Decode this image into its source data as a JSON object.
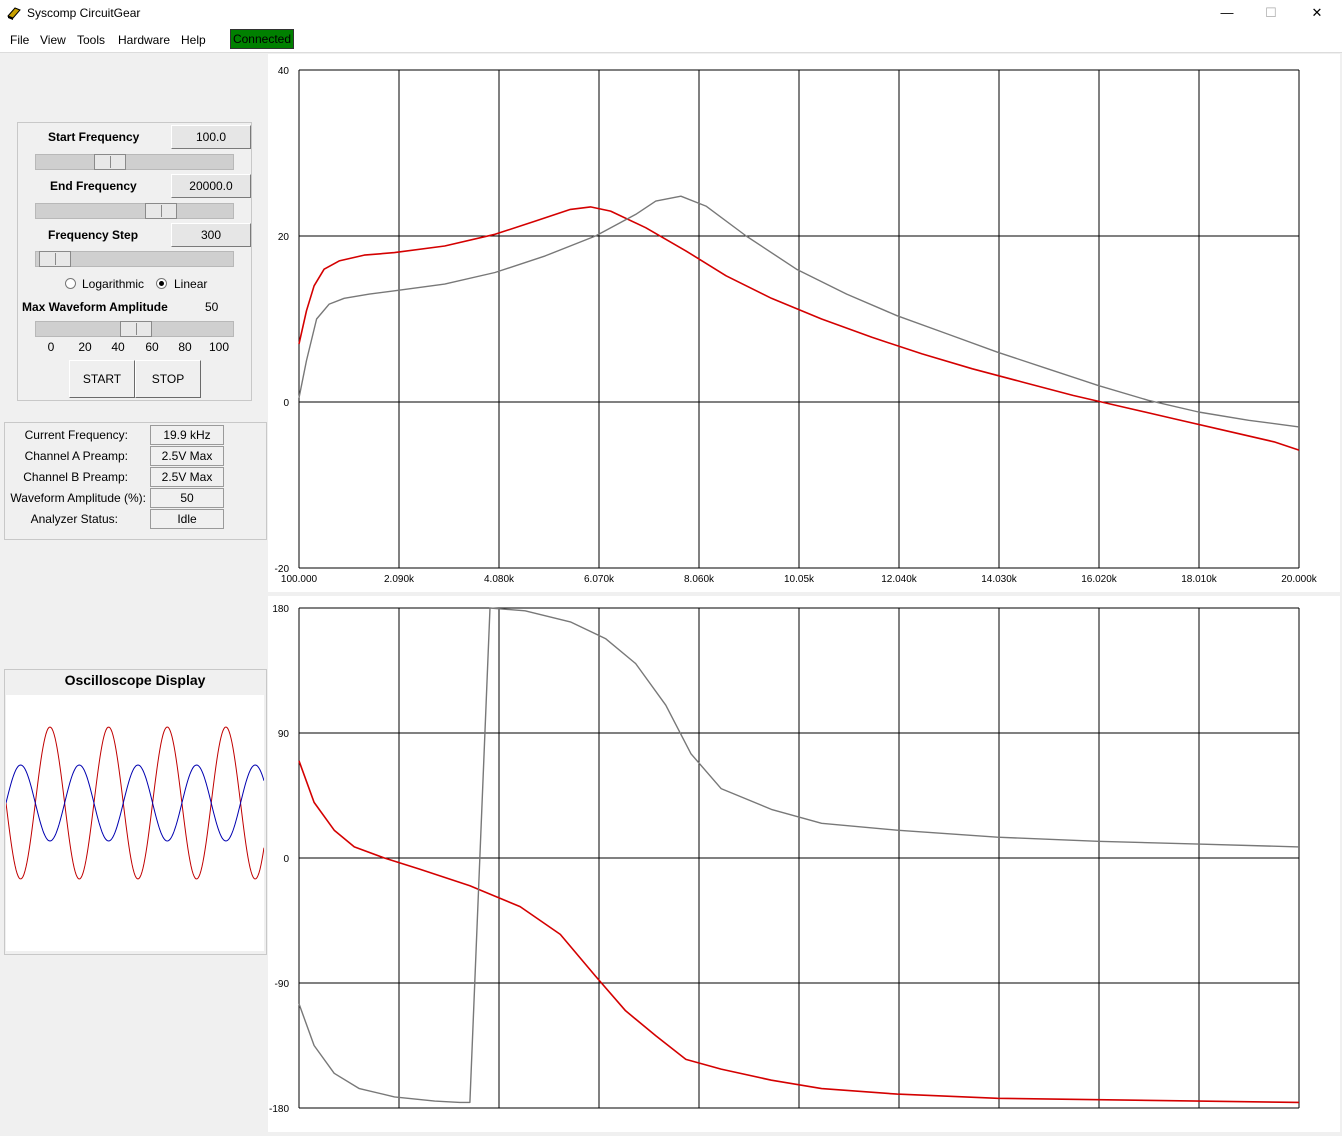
{
  "window": {
    "title": "Syscomp CircuitGear",
    "minimize": "—",
    "maximize": "☐",
    "close": "✕"
  },
  "menu": {
    "items": [
      "File",
      "View",
      "Tools",
      "Hardware",
      "Help"
    ],
    "status": "Connected",
    "status_color": "#008000"
  },
  "controls": {
    "start_frequency_label": "Start Frequency",
    "start_frequency_value": "100.0",
    "start_frequency_slider": 0.35,
    "end_frequency_label": "End Frequency",
    "end_frequency_value": "20000.0",
    "end_frequency_slider": 0.65,
    "frequency_step_label": "Frequency Step",
    "frequency_step_value": "300",
    "frequency_step_slider": 0.02,
    "scale_options": [
      "Logarithmic",
      "Linear"
    ],
    "scale_selected": "Linear",
    "max_amplitude_label": "Max Waveform Amplitude",
    "max_amplitude_value": "50",
    "max_amplitude_slider": 0.5,
    "amplitude_ticks": [
      "0",
      "20",
      "40",
      "60",
      "80",
      "100"
    ],
    "start_button": "START",
    "stop_button": "STOP"
  },
  "status": {
    "rows": [
      {
        "label": "Current Frequency:",
        "value": "19.9 kHz"
      },
      {
        "label": "Channel A Preamp:",
        "value": "2.5V Max"
      },
      {
        "label": "Channel B Preamp:",
        "value": "2.5V Max"
      },
      {
        "label": "Waveform Amplitude (%):",
        "value": "50"
      },
      {
        "label": "Analyzer Status:",
        "value": "Idle"
      }
    ]
  },
  "oscilloscope": {
    "title": "Oscilloscope Display",
    "channel_a_color": "#c00000",
    "channel_b_color": "#0000b0",
    "cycles_shown": 4.4,
    "channel_a_amplitude": 1.0,
    "channel_b_amplitude": 0.5
  },
  "chart_data": [
    {
      "type": "line",
      "title": "",
      "xlim": [
        100,
        20000
      ],
      "ylim": [
        -20,
        40
      ],
      "yticks": [
        "40",
        "20",
        "0",
        "-20"
      ],
      "xticks": [
        "100.000",
        "2.090k",
        "4.080k",
        "6.070k",
        "8.060k",
        "10.05k",
        "12.040k",
        "14.030k",
        "16.020k",
        "18.010k",
        "20.000k"
      ],
      "grid": true,
      "series": [
        {
          "color": "#d40000",
          "points": [
            [
              100,
              7
            ],
            [
              250,
              11
            ],
            [
              400,
              14
            ],
            [
              600,
              16
            ],
            [
              900,
              17
            ],
            [
              1400,
              17.7
            ],
            [
              2000,
              18.0
            ],
            [
              3000,
              18.8
            ],
            [
              4000,
              20.2
            ],
            [
              4800,
              21.8
            ],
            [
              5500,
              23.2
            ],
            [
              5900,
              23.5
            ],
            [
              6300,
              23.0
            ],
            [
              7000,
              21.0
            ],
            [
              7800,
              18.2
            ],
            [
              8600,
              15.2
            ],
            [
              9500,
              12.5
            ],
            [
              10500,
              10.0
            ],
            [
              11500,
              7.8
            ],
            [
              12500,
              5.8
            ],
            [
              13500,
              4.0
            ],
            [
              14500,
              2.4
            ],
            [
              15500,
              0.8
            ],
            [
              16500,
              -0.6
            ],
            [
              17500,
              -2.0
            ],
            [
              18500,
              -3.4
            ],
            [
              19500,
              -4.8
            ],
            [
              20000,
              -5.8
            ]
          ]
        },
        {
          "color": "#787878",
          "points": [
            [
              100,
              0.5
            ],
            [
              250,
              5
            ],
            [
              450,
              10
            ],
            [
              700,
              11.8
            ],
            [
              1000,
              12.5
            ],
            [
              1500,
              13.0
            ],
            [
              2000,
              13.4
            ],
            [
              3000,
              14.2
            ],
            [
              4000,
              15.6
            ],
            [
              5000,
              17.6
            ],
            [
              6000,
              20.0
            ],
            [
              6800,
              22.6
            ],
            [
              7200,
              24.2
            ],
            [
              7700,
              24.8
            ],
            [
              8200,
              23.6
            ],
            [
              9000,
              20.0
            ],
            [
              10000,
              16.0
            ],
            [
              11000,
              13.0
            ],
            [
              12000,
              10.4
            ],
            [
              13000,
              8.2
            ],
            [
              14000,
              6.0
            ],
            [
              15000,
              4.0
            ],
            [
              16000,
              2.0
            ],
            [
              17000,
              0.2
            ],
            [
              18000,
              -1.2
            ],
            [
              19000,
              -2.2
            ],
            [
              20000,
              -3.0
            ]
          ]
        }
      ]
    },
    {
      "type": "line",
      "title": "",
      "xlim": [
        100,
        20000
      ],
      "ylim": [
        -180,
        180
      ],
      "yticks": [
        "180",
        "90",
        "0",
        "-90",
        "-180"
      ],
      "grid": true,
      "series": [
        {
          "color": "#d40000",
          "points": [
            [
              100,
              70
            ],
            [
              400,
              40
            ],
            [
              800,
              20
            ],
            [
              1200,
              8
            ],
            [
              1800,
              0
            ],
            [
              2500,
              -8
            ],
            [
              3500,
              -20
            ],
            [
              4500,
              -35
            ],
            [
              5300,
              -55
            ],
            [
              6000,
              -85
            ],
            [
              6600,
              -110
            ],
            [
              7200,
              -128
            ],
            [
              7800,
              -145
            ],
            [
              8500,
              -152
            ],
            [
              9500,
              -160
            ],
            [
              10500,
              -166
            ],
            [
              12000,
              -170
            ],
            [
              14000,
              -173
            ],
            [
              16000,
              -174
            ],
            [
              18000,
              -175
            ],
            [
              20000,
              -176
            ]
          ]
        },
        {
          "color": "#787878",
          "points": [
            [
              100,
              -105
            ],
            [
              400,
              -135
            ],
            [
              800,
              -155
            ],
            [
              1300,
              -166
            ],
            [
              2000,
              -172
            ],
            [
              2800,
              -175
            ],
            [
              3300,
              -176
            ],
            [
              3500,
              -176
            ],
            [
              3900,
              180
            ],
            [
              4600,
              178
            ],
            [
              5500,
              170
            ],
            [
              6200,
              158
            ],
            [
              6800,
              140
            ],
            [
              7400,
              110
            ],
            [
              7900,
              75
            ],
            [
              8500,
              50
            ],
            [
              9500,
              35
            ],
            [
              10500,
              25
            ],
            [
              12000,
              20
            ],
            [
              14000,
              15
            ],
            [
              16000,
              12
            ],
            [
              18000,
              10
            ],
            [
              20000,
              8
            ]
          ]
        }
      ]
    }
  ]
}
